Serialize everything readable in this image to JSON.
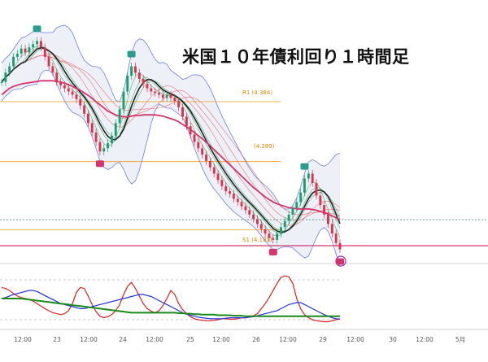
{
  "chart_data": {
    "title": "米国１０年債利回り１時間足",
    "type": "line",
    "colors": {
      "candle_up": "#1a9e6f",
      "candle_down": "#e0314b",
      "ma_slow": "#d6336c",
      "ma_mid": "#222222",
      "band_outer": "#6f7fe0",
      "band_fill": "#eef0f8",
      "ribbon_red": "#e26a6a",
      "ribbon_green": "#49a96a",
      "level_line": "#f2a93b",
      "pivot_line": "#d6336c",
      "marker_high": "#2a9d8f",
      "marker_low": "#d6336c",
      "osc_red": "#e02020",
      "osc_blue": "#2030e0",
      "osc_green": "#1a8a1a",
      "mini_marker_icon": "lightning-icon"
    },
    "x_ticks": [
      "12:00",
      "23",
      "12:00",
      "24",
      "12:00",
      "25",
      "12:00",
      "26",
      "12:00",
      "29",
      "12:00",
      "30",
      "12:00",
      "5月"
    ],
    "levels": [
      {
        "name": "R1",
        "value": 4.384,
        "label": "R1 (4.384)"
      },
      {
        "name": "P",
        "value": 4.289,
        "label": "(4.289)"
      },
      {
        "name": "S1",
        "value": 4.181,
        "label": "S1 (4.181)"
      }
    ],
    "price_close": [
      4.415,
      4.43,
      4.44,
      4.455,
      4.46,
      4.468,
      4.462,
      4.47,
      4.475,
      4.48,
      4.47,
      4.455,
      4.44,
      4.43,
      4.415,
      4.41,
      4.405,
      4.4,
      4.395,
      4.388,
      4.378,
      4.365,
      4.35,
      4.335,
      4.32,
      4.305,
      4.31,
      4.318,
      4.33,
      4.35,
      4.372,
      4.4,
      4.425,
      4.44,
      4.43,
      4.42,
      4.412,
      4.405,
      4.4,
      4.398,
      4.395,
      4.39,
      4.395,
      4.39,
      4.385,
      4.375,
      4.36,
      4.345,
      4.332,
      4.32,
      4.31,
      4.3,
      4.29,
      4.28,
      4.27,
      4.26,
      4.25,
      4.242,
      4.238,
      4.23,
      4.225,
      4.218,
      4.212,
      4.205,
      4.198,
      4.19,
      4.182,
      4.175,
      4.168,
      4.165,
      4.175,
      4.185,
      4.195,
      4.205,
      4.215,
      4.225,
      4.24,
      4.262,
      4.27,
      4.255,
      4.235,
      4.22,
      4.205,
      4.19,
      4.175,
      4.16,
      4.15
    ],
    "ma_slow": [
      4.395,
      4.4,
      4.405,
      4.408,
      4.41,
      4.412,
      4.413,
      4.414,
      4.415,
      4.416,
      4.417,
      4.417,
      4.417,
      4.417,
      4.416,
      4.415,
      4.413,
      4.411,
      4.408,
      4.405,
      4.402,
      4.398,
      4.394,
      4.389,
      4.384,
      4.379,
      4.374,
      4.369,
      4.366,
      4.363,
      4.361,
      4.36,
      4.36,
      4.361,
      4.362,
      4.362,
      4.363,
      4.363,
      4.363,
      4.363,
      4.362,
      4.361,
      4.359,
      4.357,
      4.355,
      4.352,
      4.348,
      4.344,
      4.34,
      4.335,
      4.33,
      4.325,
      4.32,
      4.314,
      4.308,
      4.302,
      4.296,
      4.29,
      4.284,
      4.278,
      4.272,
      4.266,
      4.26,
      4.254,
      4.248,
      4.243,
      4.238,
      4.233,
      4.229,
      4.225,
      4.222,
      4.22,
      4.218,
      4.216,
      4.215,
      4.214,
      4.214,
      4.214,
      4.214,
      4.213,
      4.212,
      4.21,
      4.208,
      4.206,
      4.203,
      4.2,
      4.197
    ],
    "osc_series": [
      {
        "name": "",
        "values": [
          72,
          70,
          66,
          60,
          55,
          52,
          50,
          48,
          45,
          40,
          35,
          30,
          26,
          22,
          20,
          18,
          20,
          26,
          40,
          62,
          72,
          70,
          55,
          38,
          24,
          15,
          12,
          14,
          18,
          26,
          38,
          58,
          74,
          82,
          70,
          55,
          40,
          30,
          25,
          22,
          26,
          36,
          50,
          66,
          58,
          40,
          28,
          20,
          14,
          10,
          8,
          7,
          6,
          6,
          7,
          8,
          10,
          10,
          9,
          9,
          10,
          12,
          12,
          14,
          16,
          20,
          30,
          40,
          52,
          66,
          80,
          92,
          95,
          93,
          80,
          50,
          30,
          18,
          12,
          8,
          6,
          5,
          4,
          4,
          6,
          8,
          10
        ]
      },
      {
        "name": "",
        "values": [
          50,
          52,
          55,
          58,
          60,
          62,
          64,
          66,
          66,
          64,
          60,
          56,
          52,
          48,
          44,
          40,
          38,
          36,
          34,
          32,
          30,
          30,
          32,
          34,
          36,
          38,
          40,
          42,
          44,
          46,
          48,
          50,
          52,
          54,
          56,
          58,
          58,
          56,
          54,
          50,
          46,
          42,
          38,
          34,
          30,
          26,
          22,
          19,
          17,
          15,
          13,
          12,
          11,
          10,
          10,
          10,
          10,
          11,
          12,
          12,
          12,
          12,
          12,
          13,
          14,
          16,
          18,
          20,
          22,
          24,
          26,
          30,
          34,
          38,
          40,
          42,
          42,
          38,
          34,
          30,
          26,
          22,
          18,
          15,
          12,
          10,
          9
        ]
      },
      {
        "name": "",
        "values": [
          50,
          50,
          50,
          50,
          50,
          50,
          49,
          48,
          47,
          46,
          45,
          44,
          43,
          42,
          41,
          40,
          39,
          38,
          37,
          36,
          35,
          34,
          33,
          32,
          31,
          30,
          29,
          28,
          27,
          26,
          25,
          24,
          23,
          22,
          22,
          22,
          22,
          22,
          22,
          22,
          22,
          22,
          22,
          22,
          22,
          21,
          21,
          20,
          20,
          19,
          19,
          18,
          18,
          18,
          18,
          17,
          17,
          17,
          17,
          16,
          16,
          16,
          15,
          15,
          15,
          15,
          15,
          15,
          15,
          15,
          15,
          15,
          15,
          15,
          15,
          15,
          15,
          15,
          15,
          15,
          15,
          15,
          15,
          15,
          15,
          15,
          15
        ]
      }
    ],
    "ylim": [
      4.13,
      4.545
    ],
    "osc_ylim": [
      0,
      100
    ],
    "grid": false
  }
}
